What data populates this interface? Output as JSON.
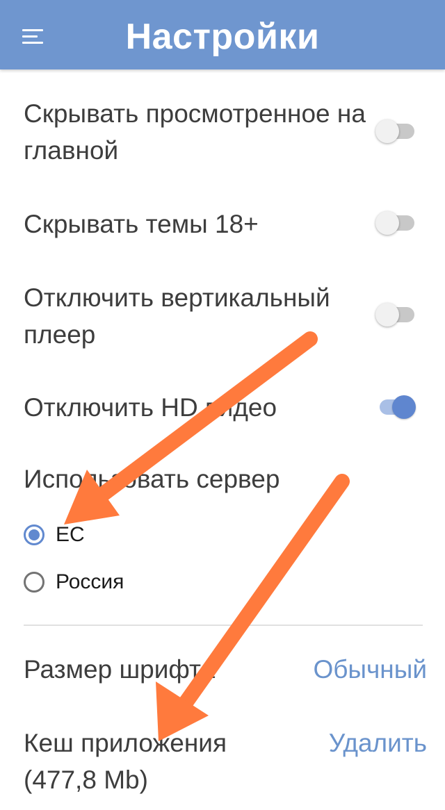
{
  "header": {
    "title": "Настройки",
    "menu_icon": "hamburger-menu-icon",
    "background_color": "#6f96cf"
  },
  "settings": {
    "hide_watched": {
      "label": "Скрывать просмотренное на главной",
      "enabled": false
    },
    "hide_18plus": {
      "label": "Скрывать темы 18+",
      "enabled": false
    },
    "disable_vertical_player": {
      "label": "Отключить вертикальный плеер",
      "enabled": false
    },
    "disable_hd_video": {
      "label": "Отключить HD видео",
      "enabled": true
    },
    "server": {
      "label": "Использовать сервер",
      "options": [
        {
          "label": "ЕС",
          "selected": true
        },
        {
          "label": "Россия",
          "selected": false
        }
      ]
    },
    "font_size": {
      "label": "Размер шрифта",
      "value": "Обычный"
    },
    "cache": {
      "label": "Кеш приложения (477,8 Mb)",
      "action": "Удалить"
    }
  },
  "colors": {
    "accent": "#6189cf",
    "link": "#6a93cc",
    "annotation_arrow": "#ff7a3d"
  }
}
